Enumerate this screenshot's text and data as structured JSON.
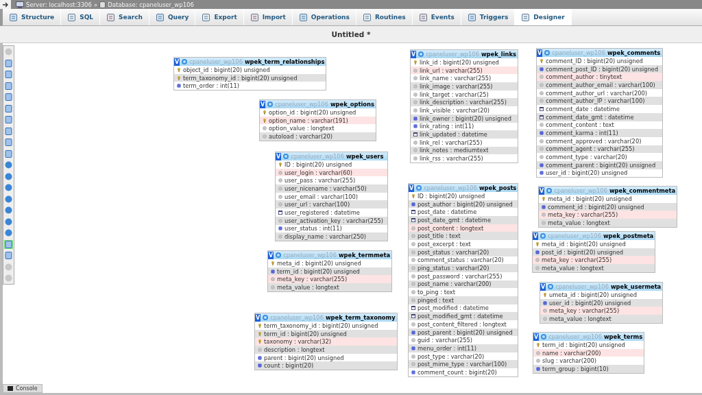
{
  "topbar": {
    "server": "Server: localhost:3306",
    "separator": "»",
    "database": "Database: cpaneluser_wp106"
  },
  "tabs": [
    {
      "label": "Structure",
      "selected": false
    },
    {
      "label": "SQL",
      "selected": false
    },
    {
      "label": "Search",
      "selected": false
    },
    {
      "label": "Query",
      "selected": false
    },
    {
      "label": "Export",
      "selected": false
    },
    {
      "label": "Import",
      "selected": false
    },
    {
      "label": "Operations",
      "selected": false
    },
    {
      "label": "Routines",
      "selected": false
    },
    {
      "label": "Events",
      "selected": false
    },
    {
      "label": "Triggers",
      "selected": false
    },
    {
      "label": "Designer",
      "selected": true
    }
  ],
  "page_title": "Untitled *",
  "toolbar_buttons": [
    {
      "selected": false
    },
    {
      "selected": false
    },
    {
      "selected": false
    },
    {
      "selected": false
    },
    {
      "selected": false
    },
    {
      "selected": false
    },
    {
      "selected": false
    },
    {
      "selected": false
    },
    {
      "selected": false
    },
    {
      "selected": false
    },
    {
      "selected": false
    },
    {
      "selected": false
    },
    {
      "selected": false
    },
    {
      "selected": false
    },
    {
      "selected": false
    },
    {
      "selected": false
    },
    {
      "selected": false
    },
    {
      "selected": true
    },
    {
      "selected": false
    },
    {
      "selected": false
    },
    {
      "selected": false
    }
  ],
  "tables": [
    {
      "toggle": "V",
      "database": "cpaneluser_wp106",
      "name": "wpek_term_relationships",
      "columns": [
        {
          "text": "object_id : bigint(20) unsigned",
          "kind": "key",
          "highlighted": false
        },
        {
          "text": "term_taxonomy_id : bigint(20) unsigned",
          "kind": "key",
          "highlighted": false
        },
        {
          "text": "term_order : int(11)",
          "kind": "number",
          "highlighted": false
        }
      ]
    },
    {
      "toggle": "V",
      "database": "cpaneluser_wp106",
      "name": "wpek_options",
      "columns": [
        {
          "text": "option_id : bigint(20) unsigned",
          "kind": "key",
          "highlighted": false
        },
        {
          "text": "option_name : varchar(191)",
          "kind": "key",
          "highlighted": true
        },
        {
          "text": "option_value : longtext",
          "kind": "text",
          "highlighted": false
        },
        {
          "text": "autoload : varchar(20)",
          "kind": "text",
          "highlighted": false
        }
      ]
    },
    {
      "toggle": "V",
      "database": "cpaneluser_wp106",
      "name": "wpek_users",
      "columns": [
        {
          "text": "ID : bigint(20) unsigned",
          "kind": "key",
          "highlighted": false
        },
        {
          "text": "user_login : varchar(60)",
          "kind": "text",
          "highlighted": true
        },
        {
          "text": "user_pass : varchar(255)",
          "kind": "text",
          "highlighted": false
        },
        {
          "text": "user_nicename : varchar(50)",
          "kind": "text",
          "highlighted": false
        },
        {
          "text": "user_email : varchar(100)",
          "kind": "text",
          "highlighted": false
        },
        {
          "text": "user_url : varchar(100)",
          "kind": "text",
          "highlighted": false
        },
        {
          "text": "user_registered : datetime",
          "kind": "date",
          "highlighted": false
        },
        {
          "text": "user_activation_key : varchar(255)",
          "kind": "text",
          "highlighted": false
        },
        {
          "text": "user_status : int(11)",
          "kind": "number",
          "highlighted": false
        },
        {
          "text": "display_name : varchar(250)",
          "kind": "text",
          "highlighted": false
        }
      ]
    },
    {
      "toggle": "V",
      "database": "cpaneluser_wp106",
      "name": "wpek_termmeta",
      "columns": [
        {
          "text": "meta_id : bigint(20) unsigned",
          "kind": "key",
          "highlighted": false
        },
        {
          "text": "term_id : bigint(20) unsigned",
          "kind": "number",
          "highlighted": false
        },
        {
          "text": "meta_key : varchar(255)",
          "kind": "text",
          "highlighted": true
        },
        {
          "text": "meta_value : longtext",
          "kind": "text",
          "highlighted": false
        }
      ]
    },
    {
      "toggle": "V",
      "database": "cpaneluser_wp106",
      "name": "wpek_term_taxonomy",
      "columns": [
        {
          "text": "term_taxonomy_id : bigint(20) unsigned",
          "kind": "key",
          "highlighted": false
        },
        {
          "text": "term_id : bigint(20) unsigned",
          "kind": "key",
          "highlighted": false
        },
        {
          "text": "taxonomy : varchar(32)",
          "kind": "key",
          "highlighted": true
        },
        {
          "text": "description : longtext",
          "kind": "text",
          "highlighted": false
        },
        {
          "text": "parent : bigint(20) unsigned",
          "kind": "number",
          "highlighted": false
        },
        {
          "text": "count : bigint(20)",
          "kind": "number",
          "highlighted": false
        }
      ]
    },
    {
      "toggle": "V",
      "database": "cpaneluser_wp106",
      "name": "wpek_links",
      "columns": [
        {
          "text": "link_id : bigint(20) unsigned",
          "kind": "key",
          "highlighted": false
        },
        {
          "text": "link_url : varchar(255)",
          "kind": "text",
          "highlighted": true
        },
        {
          "text": "link_name : varchar(255)",
          "kind": "text",
          "highlighted": false
        },
        {
          "text": "link_image : varchar(255)",
          "kind": "text",
          "highlighted": false
        },
        {
          "text": "link_target : varchar(25)",
          "kind": "text",
          "highlighted": false
        },
        {
          "text": "link_description : varchar(255)",
          "kind": "text",
          "highlighted": false
        },
        {
          "text": "link_visible : varchar(20)",
          "kind": "text",
          "highlighted": false
        },
        {
          "text": "link_owner : bigint(20) unsigned",
          "kind": "number",
          "highlighted": false
        },
        {
          "text": "link_rating : int(11)",
          "kind": "number",
          "highlighted": false
        },
        {
          "text": "link_updated : datetime",
          "kind": "date",
          "highlighted": false
        },
        {
          "text": "link_rel : varchar(255)",
          "kind": "text",
          "highlighted": false
        },
        {
          "text": "link_notes : mediumtext",
          "kind": "text",
          "highlighted": false
        },
        {
          "text": "link_rss : varchar(255)",
          "kind": "text",
          "highlighted": false
        }
      ]
    },
    {
      "toggle": "V",
      "database": "cpaneluser_wp106",
      "name": "wpek_posts",
      "columns": [
        {
          "text": "ID : bigint(20) unsigned",
          "kind": "key",
          "highlighted": false
        },
        {
          "text": "post_author : bigint(20) unsigned",
          "kind": "number",
          "highlighted": false
        },
        {
          "text": "post_date : datetime",
          "kind": "date",
          "highlighted": false
        },
        {
          "text": "post_date_gmt : datetime",
          "kind": "date",
          "highlighted": false
        },
        {
          "text": "post_content : longtext",
          "kind": "text",
          "highlighted": true
        },
        {
          "text": "post_title : text",
          "kind": "text",
          "highlighted": false
        },
        {
          "text": "post_excerpt : text",
          "kind": "text",
          "highlighted": false
        },
        {
          "text": "post_status : varchar(20)",
          "kind": "text",
          "highlighted": false
        },
        {
          "text": "comment_status : varchar(20)",
          "kind": "text",
          "highlighted": false
        },
        {
          "text": "ping_status : varchar(20)",
          "kind": "text",
          "highlighted": false
        },
        {
          "text": "post_password : varchar(255)",
          "kind": "text",
          "highlighted": false
        },
        {
          "text": "post_name : varchar(200)",
          "kind": "text",
          "highlighted": false
        },
        {
          "text": "to_ping : text",
          "kind": "text",
          "highlighted": false
        },
        {
          "text": "pinged : text",
          "kind": "text",
          "highlighted": false
        },
        {
          "text": "post_modified : datetime",
          "kind": "date",
          "highlighted": false
        },
        {
          "text": "post_modified_gmt : datetime",
          "kind": "date",
          "highlighted": false
        },
        {
          "text": "post_content_filtered : longtext",
          "kind": "text",
          "highlighted": false
        },
        {
          "text": "post_parent : bigint(20) unsigned",
          "kind": "number",
          "highlighted": false
        },
        {
          "text": "guid : varchar(255)",
          "kind": "text",
          "highlighted": false
        },
        {
          "text": "menu_order : int(11)",
          "kind": "number",
          "highlighted": false
        },
        {
          "text": "post_type : varchar(20)",
          "kind": "text",
          "highlighted": false
        },
        {
          "text": "post_mime_type : varchar(100)",
          "kind": "text",
          "highlighted": false
        },
        {
          "text": "comment_count : bigint(20)",
          "kind": "number",
          "highlighted": false
        }
      ]
    },
    {
      "toggle": "V",
      "database": "cpaneluser_wp106",
      "name": "wpek_comments",
      "columns": [
        {
          "text": "comment_ID : bigint(20) unsigned",
          "kind": "key",
          "highlighted": false
        },
        {
          "text": "comment_post_ID : bigint(20) unsigned",
          "kind": "number",
          "highlighted": false
        },
        {
          "text": "comment_author : tinytext",
          "kind": "text",
          "highlighted": true
        },
        {
          "text": "comment_author_email : varchar(100)",
          "kind": "text",
          "highlighted": false
        },
        {
          "text": "comment_author_url : varchar(200)",
          "kind": "text",
          "highlighted": false
        },
        {
          "text": "comment_author_IP : varchar(100)",
          "kind": "text",
          "highlighted": false
        },
        {
          "text": "comment_date : datetime",
          "kind": "date",
          "highlighted": false
        },
        {
          "text": "comment_date_gmt : datetime",
          "kind": "date",
          "highlighted": false
        },
        {
          "text": "comment_content : text",
          "kind": "text",
          "highlighted": false
        },
        {
          "text": "comment_karma : int(11)",
          "kind": "number",
          "highlighted": false
        },
        {
          "text": "comment_approved : varchar(20)",
          "kind": "text",
          "highlighted": false
        },
        {
          "text": "comment_agent : varchar(255)",
          "kind": "text",
          "highlighted": false
        },
        {
          "text": "comment_type : varchar(20)",
          "kind": "text",
          "highlighted": false
        },
        {
          "text": "comment_parent : bigint(20) unsigned",
          "kind": "number",
          "highlighted": false
        },
        {
          "text": "user_id : bigint(20) unsigned",
          "kind": "number",
          "highlighted": false
        }
      ]
    },
    {
      "toggle": "V",
      "database": "cpaneluser_wp106",
      "name": "wpek_commentmeta",
      "columns": [
        {
          "text": "meta_id : bigint(20) unsigned",
          "kind": "key",
          "highlighted": false
        },
        {
          "text": "comment_id : bigint(20) unsigned",
          "kind": "number",
          "highlighted": false
        },
        {
          "text": "meta_key : varchar(255)",
          "kind": "text",
          "highlighted": true
        },
        {
          "text": "meta_value : longtext",
          "kind": "text",
          "highlighted": false
        }
      ]
    },
    {
      "toggle": "V",
      "database": "cpaneluser_wp106",
      "name": "wpek_postmeta",
      "columns": [
        {
          "text": "meta_id : bigint(20) unsigned",
          "kind": "key",
          "highlighted": false
        },
        {
          "text": "post_id : bigint(20) unsigned",
          "kind": "number",
          "highlighted": false
        },
        {
          "text": "meta_key : varchar(255)",
          "kind": "text",
          "highlighted": true
        },
        {
          "text": "meta_value : longtext",
          "kind": "text",
          "highlighted": false
        }
      ]
    },
    {
      "toggle": "V",
      "database": "cpaneluser_wp106",
      "name": "wpek_usermeta",
      "columns": [
        {
          "text": "umeta_id : bigint(20) unsigned",
          "kind": "key",
          "highlighted": false
        },
        {
          "text": "user_id : bigint(20) unsigned",
          "kind": "number",
          "highlighted": false
        },
        {
          "text": "meta_key : varchar(255)",
          "kind": "text",
          "highlighted": true
        },
        {
          "text": "meta_value : longtext",
          "kind": "text",
          "highlighted": false
        }
      ]
    },
    {
      "toggle": "V",
      "database": "cpaneluser_wp106",
      "name": "wpek_terms",
      "columns": [
        {
          "text": "term_id : bigint(20) unsigned",
          "kind": "key",
          "highlighted": false
        },
        {
          "text": "name : varchar(200)",
          "kind": "text",
          "highlighted": true
        },
        {
          "text": "slug : varchar(200)",
          "kind": "text",
          "highlighted": false
        },
        {
          "text": "term_group : bigint(10)",
          "kind": "number",
          "highlighted": false
        }
      ]
    }
  ],
  "console": "Console"
}
